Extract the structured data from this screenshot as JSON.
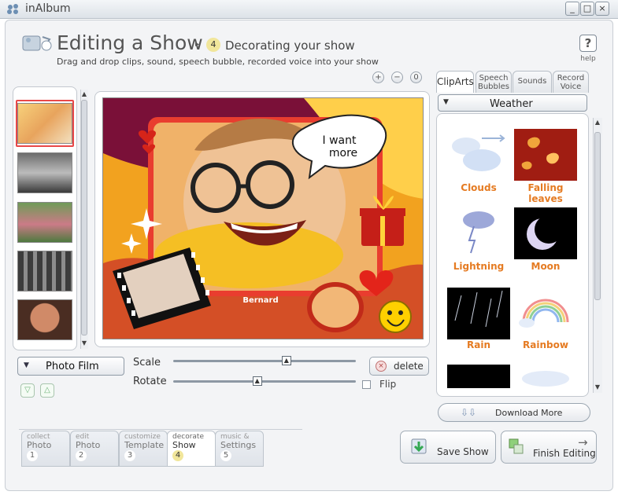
{
  "window": {
    "title": "inAlbum",
    "controls": [
      "?",
      "□",
      "×"
    ]
  },
  "header": {
    "title": "Editing a Show",
    "step_arrow": "▸",
    "step_number": "4",
    "step_title": "Decorating your show",
    "subtitle": "Drag and drop clips, sound, speech bubble, recorded voice into your show",
    "help_label": "help",
    "help_symbol": "?"
  },
  "zoom": {
    "in": "+",
    "out": "−",
    "reset": "0"
  },
  "canvas": {
    "speech_bubble": "I want more",
    "name_tag": "Bernard"
  },
  "left_controls": {
    "photo_film": "Photo Film",
    "photo_film_arrow": "▼",
    "move_down": "▽",
    "move_up": "△"
  },
  "sliders": {
    "scale": {
      "label": "Scale",
      "value": 0.62
    },
    "rotate": {
      "label": "Rotate",
      "value": 0.46
    }
  },
  "actions": {
    "delete": "delete",
    "flip": "Flip",
    "flip_checked": false
  },
  "library": {
    "tabs": [
      "ClipArts",
      "Speech Bubbles",
      "Sounds",
      "Record Voice"
    ],
    "category": "Weather",
    "category_arrow": "▼",
    "clips": [
      {
        "name": "Clouds"
      },
      {
        "name": "Falling leaves"
      },
      {
        "name": "Lightning"
      },
      {
        "name": "Moon"
      },
      {
        "name": "Rain"
      },
      {
        "name": "Rainbow"
      }
    ],
    "download_more": "Download More"
  },
  "steps": [
    {
      "top": "collect",
      "name": "Photo",
      "number": "1"
    },
    {
      "top": "edit",
      "name": "Photo",
      "number": "2"
    },
    {
      "top": "customize",
      "name": "Template",
      "number": "3"
    },
    {
      "top": "decorate",
      "name": "Show",
      "number": "4"
    },
    {
      "top": "music &",
      "name": "Settings",
      "number": "5"
    }
  ],
  "buttons": {
    "save_show": "Save Show",
    "finish_editing": "Finish Editing"
  },
  "colors": {
    "accent": "#e57b22",
    "selected": "#e94848"
  }
}
